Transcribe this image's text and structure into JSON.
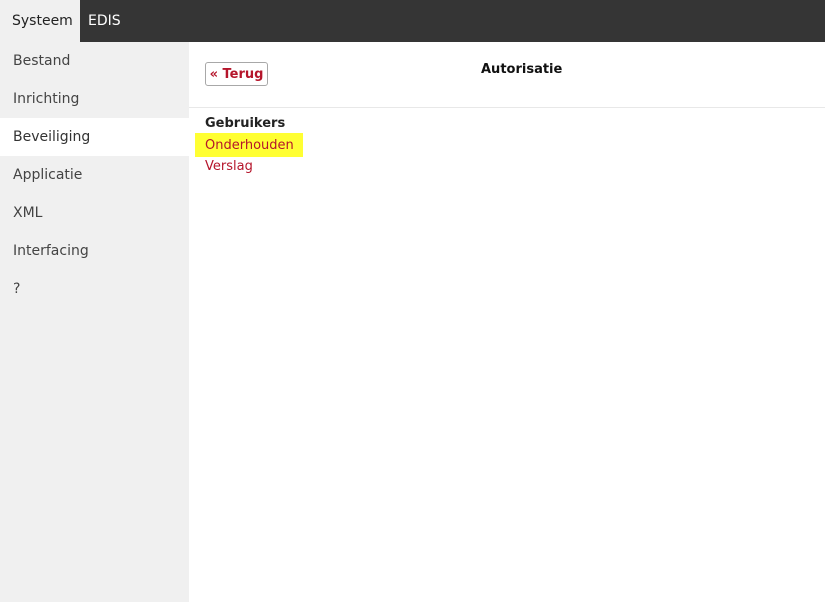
{
  "topbar": {
    "tabs": [
      {
        "label": "Systeem",
        "active": true
      },
      {
        "label": "EDIS",
        "active": false
      }
    ]
  },
  "sidebar": {
    "items": [
      {
        "label": "Bestand"
      },
      {
        "label": "Inrichting"
      },
      {
        "label": "Beveiliging",
        "active": true
      },
      {
        "label": "Applicatie"
      },
      {
        "label": "XML"
      },
      {
        "label": "Interfacing"
      },
      {
        "label": "?"
      }
    ]
  },
  "header": {
    "back_label": "« Terug",
    "title": "Autorisatie"
  },
  "content": {
    "section_heading": "Gebruikers",
    "links": [
      {
        "label": "Onderhouden",
        "highlighted": true
      },
      {
        "label": "Verslag",
        "highlighted": false
      }
    ]
  },
  "colors": {
    "topbar": "#353535",
    "sidebar": "#f0f0f0",
    "link": "#b5152b",
    "highlight": "#ffff33"
  }
}
